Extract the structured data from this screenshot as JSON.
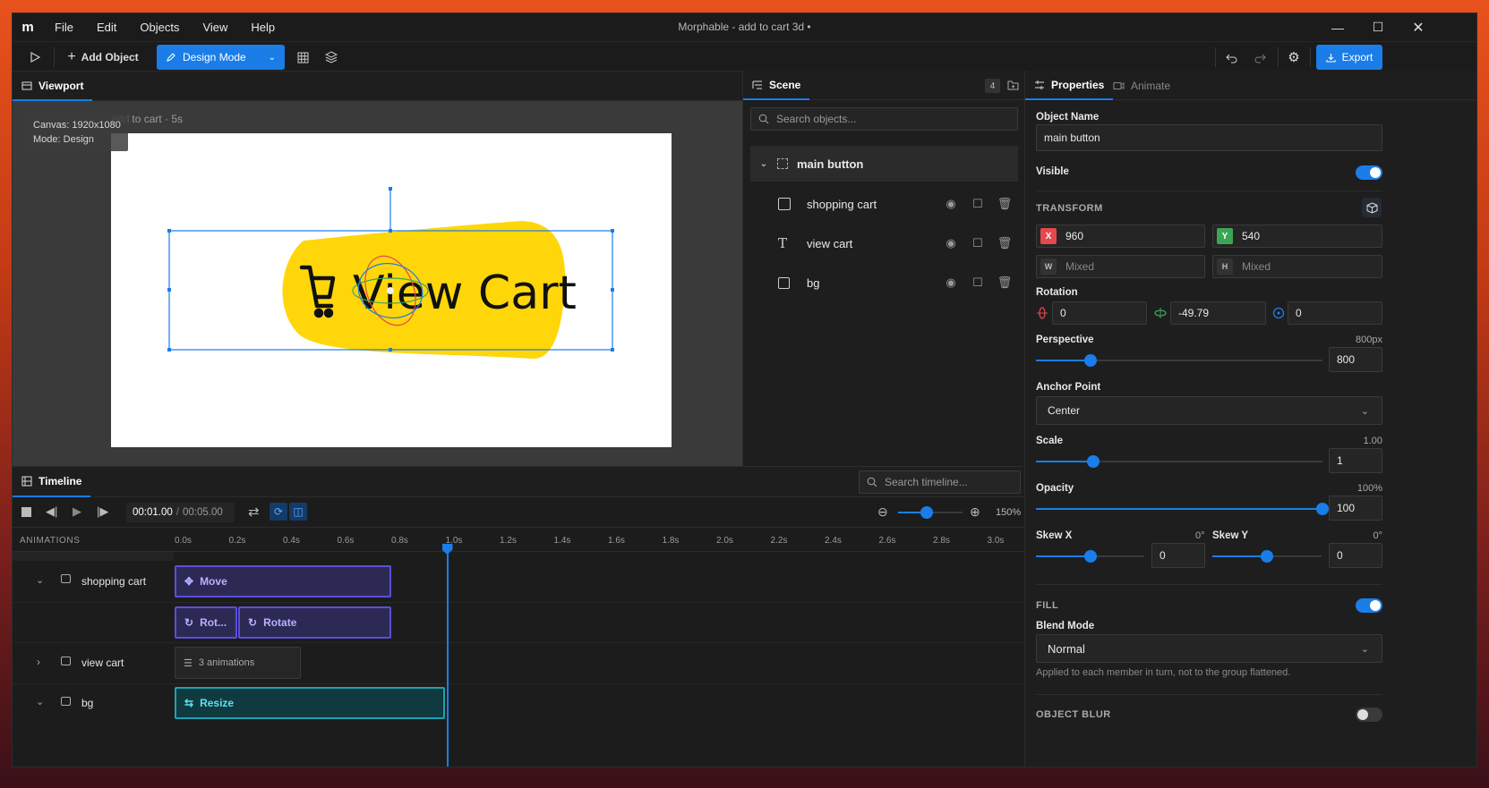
{
  "app": {
    "title": "Morphable - add to cart 3d •",
    "menu": [
      "File",
      "Edit",
      "Objects",
      "View",
      "Help"
    ]
  },
  "toolbar": {
    "add_object": "Add Object",
    "mode": "Design Mode",
    "export": "Export"
  },
  "viewport": {
    "tab": "Viewport",
    "overlay_line1": "Canvas: 1920x1080",
    "overlay_line2": "Mode: Design",
    "canvas_label": "add to cart · 5s",
    "button_text": "View Cart"
  },
  "scene": {
    "tab": "Scene",
    "count": "4",
    "search_placeholder": "Search objects...",
    "group": "main button",
    "children": [
      {
        "label": "shopping cart",
        "icon": "image-icon"
      },
      {
        "label": "view cart",
        "icon": "text-icon"
      },
      {
        "label": "bg",
        "icon": "rectangle-icon"
      }
    ]
  },
  "properties": {
    "tab_properties": "Properties",
    "tab_animate": "Animate",
    "object_name_label": "Object Name",
    "object_name": "main button",
    "visible_label": "Visible",
    "visible": true,
    "transform_label": "TRANSFORM",
    "x_label": "X",
    "x": "960",
    "y_label": "Y",
    "y": "540",
    "w_label": "W",
    "w": "Mixed",
    "h_label": "H",
    "h": "Mixed",
    "rotation_label": "Rotation",
    "rot_x": "0",
    "rot_y": "-49.79",
    "rot_z": "0",
    "perspective_label": "Perspective",
    "perspective_display": "800px",
    "perspective_value": "800",
    "perspective_fraction": 0.19,
    "anchor_label": "Anchor Point",
    "anchor": "Center",
    "scale_label": "Scale",
    "scale_display": "1.00",
    "scale_value": "1",
    "scale_fraction": 0.2,
    "opacity_label": "Opacity",
    "opacity_display": "100%",
    "opacity_value": "100",
    "opacity_fraction": 1.0,
    "skew_x_label": "Skew X",
    "skew_x_display": "0°",
    "skew_x_value": "0",
    "skew_x_fraction": 0.5,
    "skew_y_label": "Skew Y",
    "skew_y_display": "0°",
    "skew_y_value": "0",
    "skew_y_fraction": 0.5,
    "fill_label": "FILL",
    "fill": true,
    "blend_label": "Blend Mode",
    "blend": "Normal",
    "blend_hint": "Applied to each member in turn, not to the group flattened.",
    "object_blur_label": "OBJECT BLUR",
    "object_blur": false
  },
  "timeline": {
    "tab": "Timeline",
    "search_placeholder": "Search timeline...",
    "time_current": "00:01.00",
    "time_sep": "/",
    "time_total": "00:05.00",
    "zoom": "150%",
    "zoom_fraction": 0.45,
    "animations_label": "ANIMATIONS",
    "ruler": [
      "0.0s",
      "0.2s",
      "0.4s",
      "0.6s",
      "0.8s",
      "1.0s",
      "1.2s",
      "1.4s",
      "1.6s",
      "1.8s",
      "2.0s",
      "2.2s",
      "2.4s",
      "2.6s",
      "2.8s",
      "3.0s"
    ],
    "playhead_seconds": 1.0,
    "tracks": [
      {
        "label": "shopping cart",
        "expanded": true
      },
      {
        "label": "view cart",
        "expanded": false
      },
      {
        "label": "bg",
        "expanded": true
      }
    ],
    "clips": {
      "move": "Move",
      "rot_short": "Rot...",
      "rotate": "Rotate",
      "view_cart_anims": "3 animations",
      "resize": "Resize"
    }
  },
  "colors": {
    "accent": "#1a7de8",
    "button_yellow": "#ffd60a",
    "clip_purple": "#5a4fd8",
    "clip_teal": "#1fa2b3",
    "x_badge": "#e5484d",
    "y_badge": "#3aa655"
  }
}
